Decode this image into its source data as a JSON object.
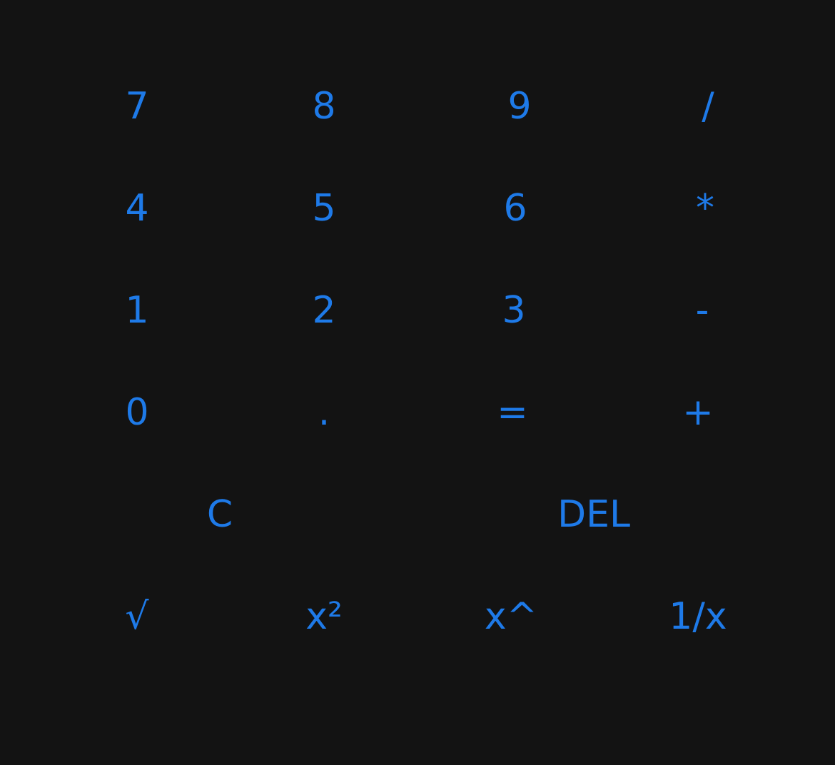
{
  "app": {
    "theme_colors": {
      "background": "#131313",
      "accent": "#1e7ae8"
    }
  },
  "keypad": {
    "rows": [
      [
        "7",
        "8",
        "9",
        "/"
      ],
      [
        "4",
        "5",
        "6",
        "*"
      ],
      [
        "1",
        "2",
        "3",
        "-"
      ],
      [
        "0",
        ".",
        "=",
        "+"
      ],
      [
        "C",
        "DEL"
      ],
      [
        "√",
        "x²",
        "x^",
        "1/x"
      ]
    ]
  }
}
